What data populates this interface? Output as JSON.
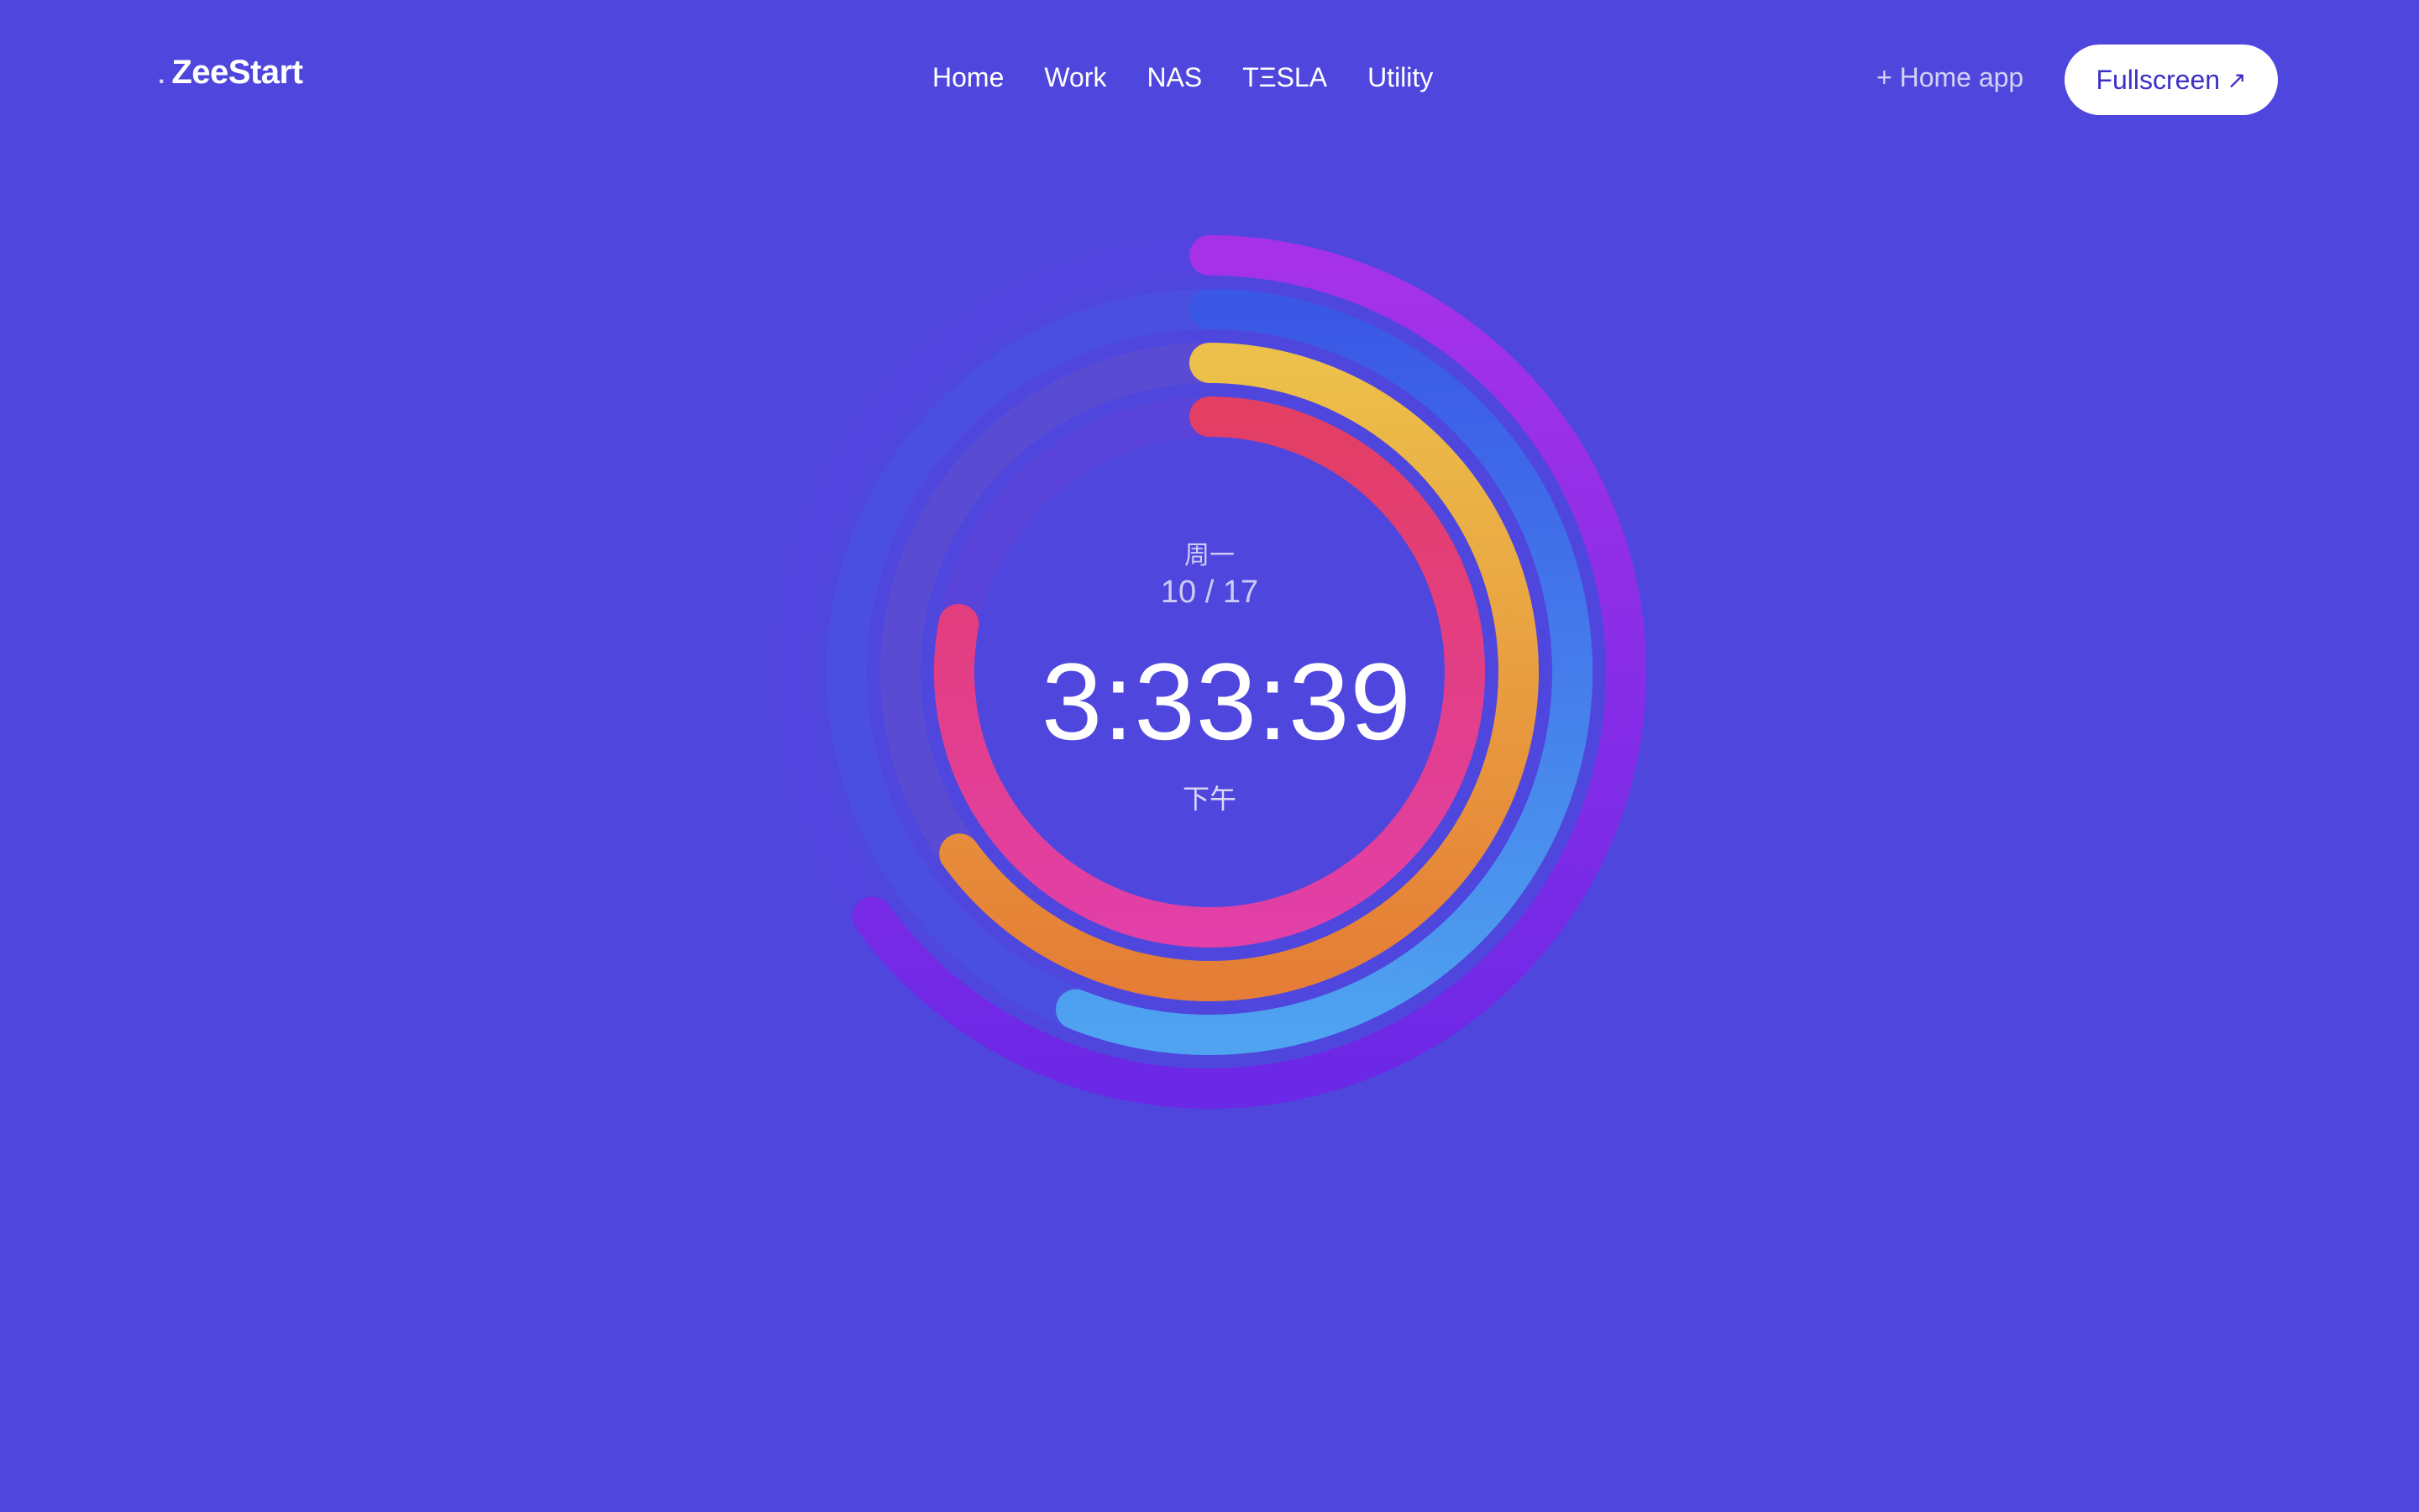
{
  "brand": {
    "prefix": ".",
    "name": "ZeeStart"
  },
  "nav": {
    "items": [
      {
        "label": "Home"
      },
      {
        "label": "Work"
      },
      {
        "label": "NAS"
      },
      {
        "label": "TΞSLA"
      },
      {
        "label": "Utility"
      }
    ]
  },
  "header": {
    "home_app_label": "+ Home app",
    "fullscreen_label": "Fullscreen",
    "fullscreen_icon": "arrow-up-right-icon"
  },
  "clock": {
    "weekday": "周一",
    "date": "10 / 17",
    "time": "3:33:39",
    "period": "下午"
  },
  "rings": [
    {
      "name": "outer",
      "progress": 0.65,
      "colors": [
        "#a632e8",
        "#6b28e6"
      ]
    },
    {
      "name": "second",
      "progress": 0.56,
      "colors": [
        "#3a57e6",
        "#4fa3f0"
      ]
    },
    {
      "name": "third",
      "progress": 0.65,
      "colors": [
        "#ecc04a",
        "#e57d36"
      ]
    },
    {
      "name": "inner",
      "progress": 0.78,
      "colors": [
        "#e33e63",
        "#e23fa8"
      ]
    }
  ],
  "colors": {
    "background": "#4f47dd",
    "button_text": "#3d2fc8"
  }
}
